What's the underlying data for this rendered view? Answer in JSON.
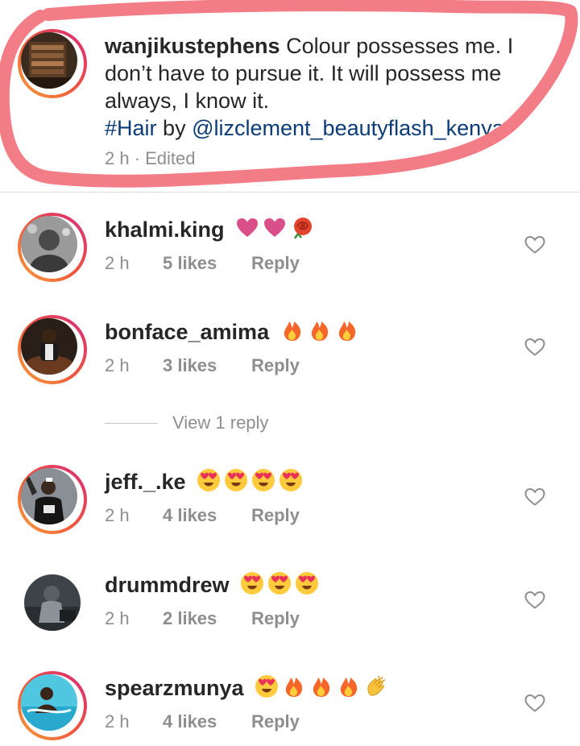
{
  "caption": {
    "username": "wanjikustephens",
    "text": "Colour possesses me. I don’t have to pursue it. It will possess me always, I know it.",
    "hashtag": "#Hair",
    "by": "by",
    "mention": "@lizclement_beautyflash_kenya",
    "meta": "2 h · Edited",
    "highlight_color": "#f27d86"
  },
  "comments": [
    {
      "username": "khalmi.king",
      "emojis": [
        "heart-emoji",
        "heart-emoji",
        "rose-emoji"
      ],
      "time": "2 h",
      "likes": "5 likes",
      "reply": "Reply"
    },
    {
      "username": "bonface_amima",
      "emojis": [
        "fire-emoji",
        "fire-emoji",
        "fire-emoji"
      ],
      "time": "2 h",
      "likes": "3 likes",
      "reply": "Reply"
    },
    {
      "username": "jeff._.ke",
      "emojis": [
        "heart-eyes-emoji",
        "heart-eyes-emoji",
        "heart-eyes-emoji",
        "heart-eyes-emoji"
      ],
      "time": "2 h",
      "likes": "4 likes",
      "reply": "Reply"
    },
    {
      "username": "drummdrew",
      "emojis": [
        "heart-eyes-emoji",
        "heart-eyes-emoji",
        "heart-eyes-emoji"
      ],
      "time": "2 h",
      "likes": "2 likes",
      "reply": "Reply"
    },
    {
      "username": "spearzmunya",
      "emojis": [
        "heart-eyes-emoji",
        "fire-emoji",
        "fire-emoji",
        "fire-emoji",
        "clap-emoji"
      ],
      "time": "2 h",
      "likes": "4 likes",
      "reply": "Reply"
    }
  ],
  "view_replies": "View 1 reply",
  "colors": {
    "ring_start": "#f6a03a",
    "ring_end": "#d72a7a",
    "muted": "#8e8e8e",
    "link": "#0b3c77"
  }
}
